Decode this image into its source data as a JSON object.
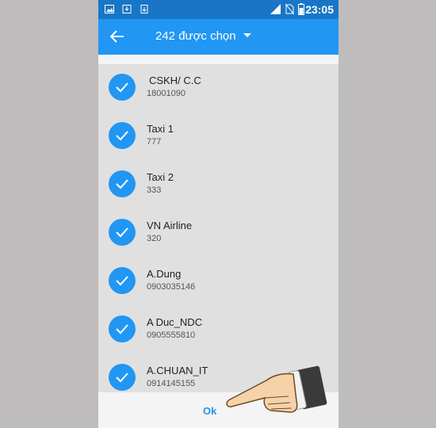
{
  "status_bar": {
    "time": "23:05",
    "icons": [
      "image-icon",
      "download-icon",
      "phone-data-icon",
      "signal-icon",
      "no-sim-icon",
      "battery-icon"
    ]
  },
  "toolbar": {
    "title": "242 được chọn",
    "back_icon": "back-arrow-icon",
    "dropdown_icon": "caret-down-icon"
  },
  "contacts": [
    {
      "name": "CSKH/ C.C",
      "number": "18001090",
      "selected": true
    },
    {
      "name": "Taxi 1",
      "number": "777",
      "selected": true
    },
    {
      "name": "Taxi 2",
      "number": "333",
      "selected": true
    },
    {
      "name": "VN Airline",
      "number": "320",
      "selected": true
    },
    {
      "name": "A.Dung",
      "number": "0903035146",
      "selected": true
    },
    {
      "name": "A Duc_NDC",
      "number": "0905555810",
      "selected": true
    },
    {
      "name": "A.CHUAN_IT",
      "number": "0914145155",
      "selected": true
    }
  ],
  "footer": {
    "ok_label": "Ok"
  },
  "colors": {
    "statusbar": "#1976c6",
    "toolbar": "#2196f3",
    "list_bg": "#e0e0e0",
    "check": "#2196f3",
    "page_bg": "#bebcbd"
  }
}
